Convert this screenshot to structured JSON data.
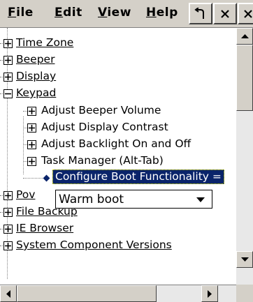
{
  "menubar": {
    "items": [
      {
        "label": "File",
        "mnemonic": "F",
        "rest": "ile"
      },
      {
        "label": "Edit",
        "mnemonic": "E",
        "rest": "dit"
      },
      {
        "label": "View",
        "mnemonic": "V",
        "rest": "iew"
      },
      {
        "label": "Help",
        "mnemonic": "H",
        "rest": "elp"
      }
    ],
    "buttons": [
      "undo-icon",
      "close-icon",
      "close-icon"
    ]
  },
  "tree": {
    "items": [
      {
        "label": "Time Zone",
        "state": "collapsed",
        "link": true
      },
      {
        "label": "Beeper",
        "state": "collapsed",
        "link": true
      },
      {
        "label": "Display",
        "state": "collapsed",
        "link": true
      },
      {
        "label": "Keypad",
        "state": "expanded",
        "link": true
      },
      {
        "label": "Adjust Beeper Volume",
        "state": "collapsed",
        "link": false
      },
      {
        "label": "Adjust Display Contrast",
        "state": "collapsed",
        "link": false
      },
      {
        "label": "Adjust Backlight On and Off",
        "state": "collapsed",
        "link": false
      },
      {
        "label": "Task Manager (Alt-Tab)",
        "state": "collapsed",
        "link": false
      },
      {
        "label": "Configure Boot Functionality =",
        "state": "leaf",
        "link": false,
        "selected": true
      },
      {
        "label": "Pov",
        "state": "collapsed",
        "link": true
      },
      {
        "label": "File Backup",
        "state": "collapsed",
        "link": true
      },
      {
        "label": "IE Browser",
        "state": "collapsed",
        "link": true
      },
      {
        "label": "System Component Versions",
        "state": "collapsed",
        "link": true
      }
    ],
    "dropdown": {
      "value": "Warm boot"
    }
  },
  "colors": {
    "chrome": "#d4d0c8",
    "selection": "#0a246a"
  }
}
